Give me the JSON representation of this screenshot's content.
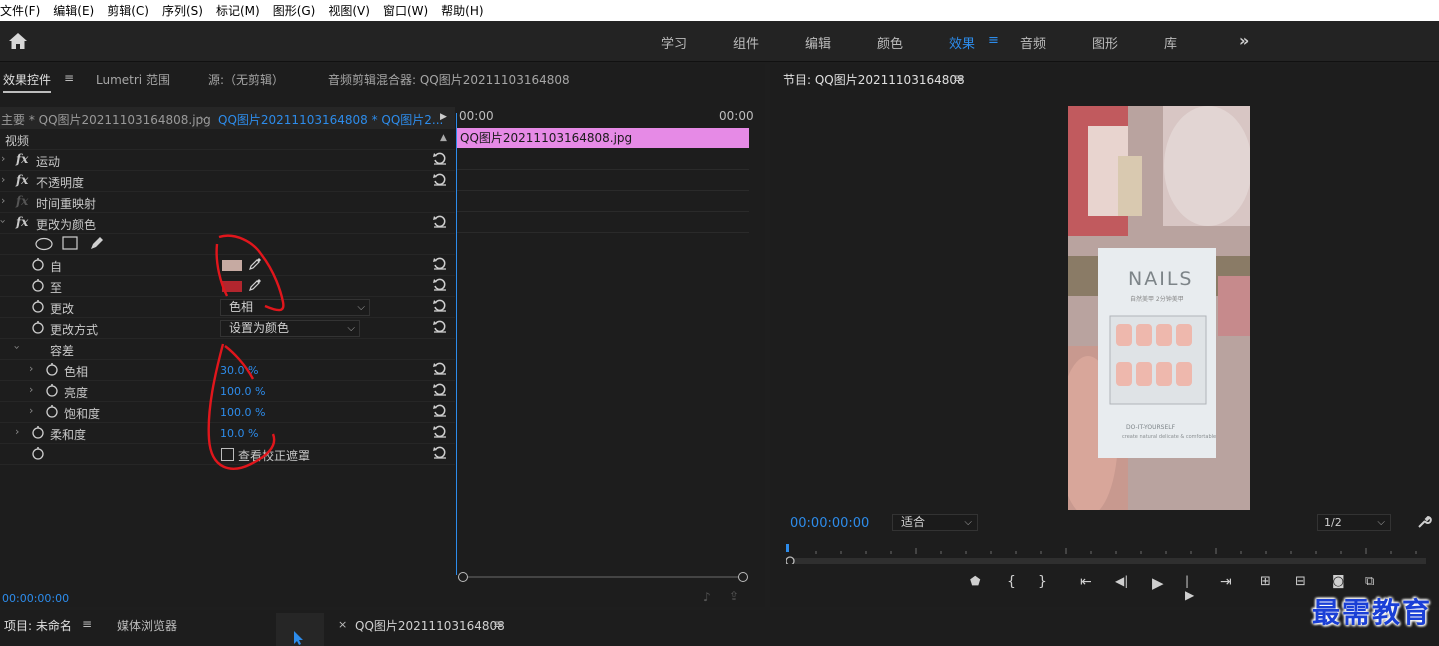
{
  "menu": [
    "文件(F)",
    "编辑(E)",
    "剪辑(C)",
    "序列(S)",
    "标记(M)",
    "图形(G)",
    "视图(V)",
    "窗口(W)",
    "帮助(H)"
  ],
  "workspace_tabs": [
    "学习",
    "组件",
    "编辑",
    "颜色",
    "效果",
    "音频",
    "图形",
    "库"
  ],
  "workspace_active": "效果",
  "effect_panel": {
    "tabs": [
      "效果控件",
      "Lumetri 范围",
      "源:（无剪辑）",
      "音频剪辑混合器: QQ图片20211103164808"
    ],
    "tab_menu": "≡",
    "master_clip": "主要 * QQ图片20211103164808.jpg",
    "sequence_clip": "QQ图片20211103164808 * QQ图片2...",
    "tl_start": "00:00",
    "tl_end": "00:00",
    "clip_name": "QQ图片20211103164808.jpg",
    "current_time": "00:00:00:00"
  },
  "effects": {
    "video_header": "视频",
    "motion": "运动",
    "opacity": "不透明度",
    "time_remap": "时间重映射",
    "change_to_color": "更改为颜色",
    "from": "自",
    "to": "至",
    "change": "更改",
    "change_value": "色相",
    "change_by": "更改方式",
    "change_by_value": "设置为颜色",
    "tolerance": "容差",
    "hue": "色相",
    "hue_value": "30.0 %",
    "lightness": "亮度",
    "lightness_value": "100.0 %",
    "saturation": "饱和度",
    "saturation_value": "100.0 %",
    "softness": "柔和度",
    "softness_value": "10.0 %",
    "view_matte": "查看校正遮罩",
    "from_color": "#c6aaa2",
    "to_color": "#b2262e"
  },
  "program": {
    "title": "节目: QQ图片20211103164808",
    "menu": "≡",
    "timecode": "00:00:00:00",
    "fit": "适合",
    "resolution": "1/2",
    "nails_brand": "NAILS",
    "nails_sub": "自然美甲 2分钟美甲",
    "nails_diy": "DO-IT-YOURSELF",
    "nails_small": "create natural delicate & comfortable"
  },
  "bottom": {
    "project_tab": "项目: 未命名",
    "media_tab": "媒体浏览器",
    "sequence_tab": "QQ图片20211103164808",
    "menu": "≡",
    "close": "×"
  },
  "watermark": "最需教育"
}
